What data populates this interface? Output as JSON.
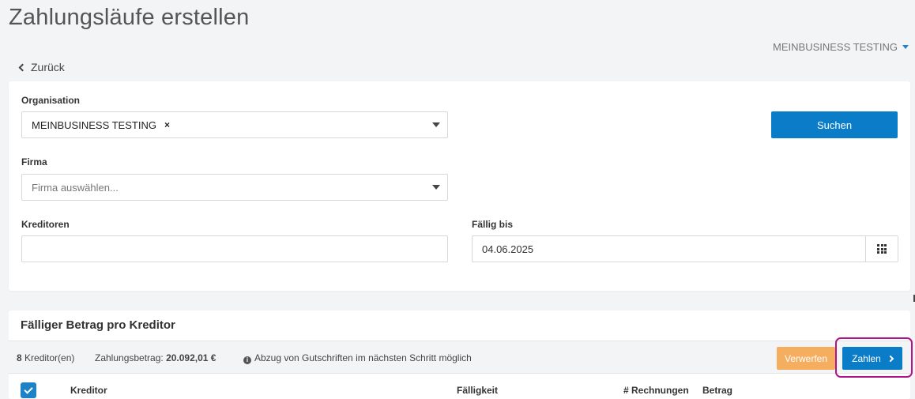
{
  "page_title": "Zahlungsläufe erstellen",
  "org_switcher": "MEINBUSINESS TESTING",
  "back_link": "Zurück",
  "filters": {
    "organisation_label": "Organisation",
    "organisation_value": "MEINBUSINESS TESTING",
    "organisation_remove": "×",
    "firma_label": "Firma",
    "firma_placeholder": "Firma auswählen...",
    "kreditoren_label": "Kreditoren",
    "kreditoren_value": "",
    "faellig_label": "Fällig bis",
    "faellig_value": "04.06.2025",
    "search_button": "Suchen"
  },
  "results": {
    "title": "Fälliger Betrag pro Kreditor",
    "count_number": "8",
    "count_suffix": "Kreditor(en)",
    "amount_label": "Zahlungsbetrag:",
    "amount_value": "20.092,01 €",
    "info_text": "Abzug von Gutschriften im nächsten Schritt möglich",
    "discard_button": "Verwerfen",
    "pay_button": "Zahlen",
    "columns": [
      "Kreditor",
      "Fälligkeit",
      "# Rechnungen",
      "Betrag"
    ]
  },
  "colors": {
    "primary": "#0a7cc8",
    "warning": "#f5ad5f",
    "highlight": "#b0138a"
  }
}
